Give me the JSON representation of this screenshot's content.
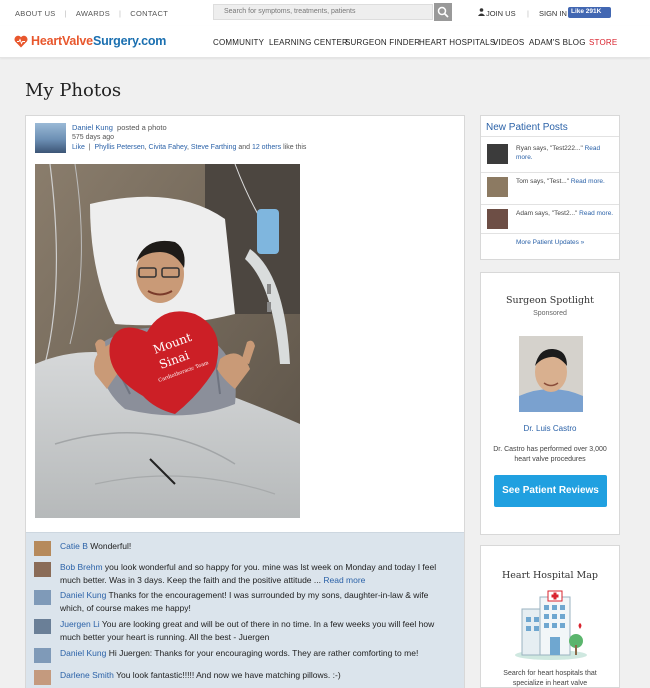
{
  "top_bar": {
    "links": [
      "ABOUT US",
      "AWARDS",
      "CONTACT"
    ],
    "search_placeholder": "Search for symptoms, treatments, patients",
    "join": "JOIN US",
    "signin": "SIGN IN",
    "fb_like": "Like 291K"
  },
  "brand": {
    "name_part1": "HeartValve",
    "name_part2": "Surgery.com",
    "colors": {
      "blue": "#1a6fb0",
      "orange": "#e8572d"
    }
  },
  "nav": {
    "items": [
      "COMMUNITY",
      "LEARNING CENTER",
      "SURGEON FINDER",
      "HEART HOSPITALS",
      "VIDEOS",
      "ADAM'S BLOG",
      "STORE"
    ]
  },
  "page": {
    "title": "My Photos"
  },
  "post": {
    "author": "Daniel Kung",
    "action": "posted a photo",
    "time_ago": "575 days ago",
    "like_label": "Like",
    "liked_by": [
      "Phyllis Petersen",
      "Civita Fahey",
      "Steve Farthing"
    ],
    "and_label": "and",
    "others": "12 others",
    "like_suffix": "like this",
    "pillow_text_line1": "Mount",
    "pillow_text_line2": "Sinai",
    "pillow_text_line3": "Cardiothoracic Team"
  },
  "comments": [
    {
      "name": "Catie B",
      "text": "Wonderful!"
    },
    {
      "name": "Bob Brehm",
      "text": "you look wonderful and so happy for you. mine was lst week on Monday and today I feel much better. Was in 3 days. Keep the faith and the positive attitude ...",
      "read_more": "Read more"
    },
    {
      "name": "Daniel Kung",
      "text": "Thanks for the encouragement! I was surrounded by my sons, daughter-in-law & wife which, of course makes me happy!"
    },
    {
      "name": "Juergen Li",
      "text": "You are looking great and will be out of there in no time. In a few weeks you will feel how much better your heart is running. All the best - Juergen"
    },
    {
      "name": "Daniel Kung",
      "text": "Hi Juergen: Thanks for your encouraging words. They are rather comforting to me!"
    },
    {
      "name": "Darlene Smith",
      "text": "You look fantastic!!!!! And now we have matching pillows. :-)"
    }
  ],
  "sidebar": {
    "new_posts": {
      "title": "New Patient Posts",
      "items": [
        {
          "text": "Ryan says, \"Test222...\"",
          "read_more": "Read more."
        },
        {
          "text": "Tom says, \"Test...\"",
          "read_more": "Read more."
        },
        {
          "text": "Adam says, \"Test2...\"",
          "read_more": "Read more."
        }
      ],
      "more_link": "More Patient Updates »"
    },
    "spotlight": {
      "title": "Surgeon Spotlight",
      "sponsored": "Sponsored",
      "doctor_name": "Dr. Luis Castro",
      "description": "Dr. Castro has performed over 3,000 heart valve procedures",
      "button": "See Patient Reviews",
      "button_color": "#20a0e0"
    },
    "hospital_map": {
      "title": "Heart Hospital Map",
      "description": "Search for heart hospitals that specialize in heart valve"
    }
  }
}
